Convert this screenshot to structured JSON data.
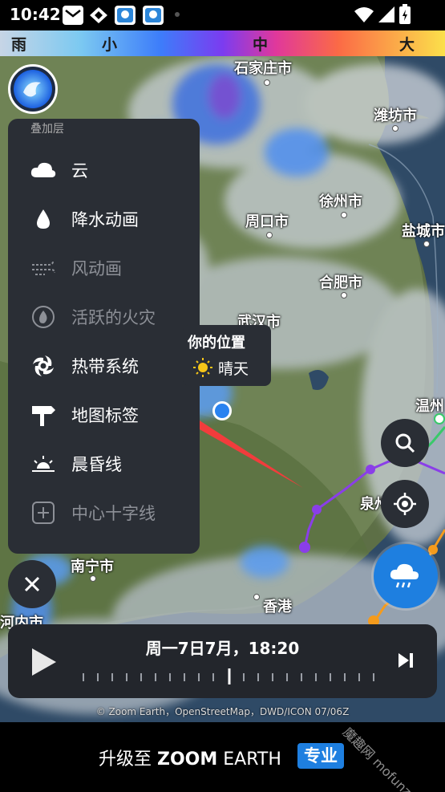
{
  "status_bar": {
    "time": "10:42"
  },
  "legend": {
    "labels": [
      "雨",
      "小",
      "中",
      "大"
    ]
  },
  "cities": [
    {
      "name": "石家庄市",
      "key": "shijiazhuang"
    },
    {
      "name": "潍坊市",
      "key": "weifang"
    },
    {
      "name": "徐州市",
      "key": "xuzhou"
    },
    {
      "name": "周口市",
      "key": "zhoukou"
    },
    {
      "name": "盐城市",
      "key": "yancheng"
    },
    {
      "name": "合肥市",
      "key": "hefei"
    },
    {
      "name": "武汉市",
      "key": "wuhan"
    },
    {
      "name": "温州",
      "key": "wenzhou"
    },
    {
      "name": "泉州",
      "key": "quanzhou"
    },
    {
      "name": "南宁市",
      "key": "nanning"
    },
    {
      "name": "香港",
      "key": "hongkong"
    },
    {
      "name": "河内市",
      "key": "hanoi"
    }
  ],
  "layer_panel": {
    "header": "叠加层",
    "items": [
      {
        "label": "云",
        "icon": "cloud-icon",
        "active": true
      },
      {
        "label": "降水动画",
        "icon": "raindrop-icon",
        "active": true
      },
      {
        "label": "风动画",
        "icon": "wind-icon",
        "active": false
      },
      {
        "label": "活跃的火灾",
        "icon": "fire-icon",
        "active": false
      },
      {
        "label": "热带系统",
        "icon": "hurricane-icon",
        "active": true
      },
      {
        "label": "地图标签",
        "icon": "signpost-icon",
        "active": true
      },
      {
        "label": "晨昏线",
        "icon": "sunrise-icon",
        "active": true
      },
      {
        "label": "中心十字线",
        "icon": "crosshair-box-icon",
        "active": false
      }
    ]
  },
  "location_tooltip": {
    "title": "你的位置",
    "weather": "晴天"
  },
  "timebar": {
    "datetime": "周一7日7月，18:20"
  },
  "attribution": "© Zoom Earth，OpenStreetMap，DWD/ICON 07/06Z",
  "upgrade": {
    "prefix": "升级至 ",
    "brand": "ZOOM",
    "brand2": " EARTH",
    "badge": "专业"
  },
  "watermark": "魔趣网 mofunz.com",
  "colors": {
    "accent": "#1e7fe0",
    "panel": "#2a2e35",
    "track": "#8a3ee8",
    "arrow": "#f23c3c"
  }
}
